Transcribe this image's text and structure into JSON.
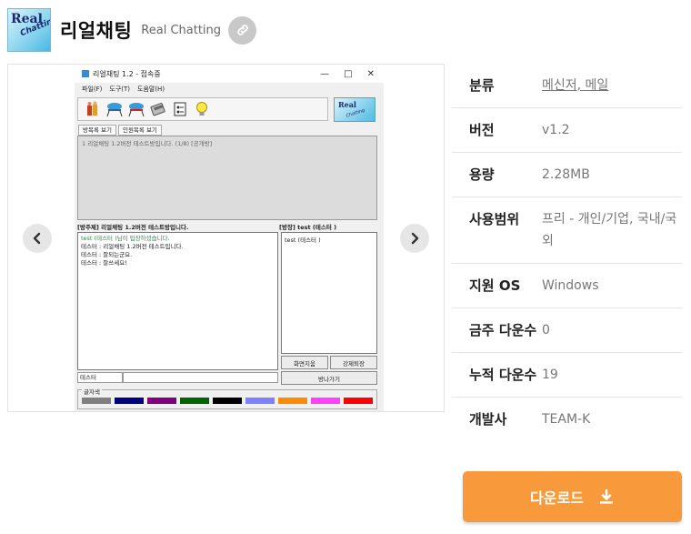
{
  "app": {
    "logo_line1": "Real",
    "logo_line2": "Chatting",
    "title": "리얼채팅",
    "subtitle": "Real Chatting",
    "link_icon": "link-icon"
  },
  "screenshot": {
    "window_title": "리얼채팅 1.2 - 접속중",
    "window_controls": [
      "—",
      "□",
      "✕"
    ],
    "menu": [
      "파일(F)",
      "도구(T)",
      "도움말(H)"
    ],
    "logo_line1": "Real",
    "logo_line2": "Chatting",
    "tabs": [
      "방목록 보기",
      "인원목록 보기"
    ],
    "room_list_entry": "1  리얼채팅 1.2버전 테스트방입니다. (1/8) [공개방]",
    "room_bar": "[방주제] 리얼채팅 1.2버전 테스트방입니다.",
    "owner_bar": "[방장] test  (테스터          )",
    "chat_lines": [
      "test  (테스터         )님이 입장하셨습니다.",
      "테스터 : 리얼채팅 1.2버전 테스트입니다.",
      "테스터 : 잘되는군요.",
      "테스터 : 잘쓰세요!"
    ],
    "user_list_entry": "test   (테스터          )",
    "buttons": {
      "clear": "화면지움",
      "kick": "강제퇴장",
      "leave": "방나가기"
    },
    "nickname": "테스터",
    "color_label": "글자색",
    "swatch_colors": [
      "#808080",
      "#000080",
      "#800080",
      "#006400",
      "#000000",
      "#8080ff",
      "#ff8c00",
      "#ff40ff",
      "#ff0000"
    ],
    "prev_icon": "chevron-left-icon",
    "next_icon": "chevron-right-icon"
  },
  "info": {
    "category_label": "분류",
    "category_value": "메신저, 메일",
    "version_label": "버전",
    "version_value": "v1.2",
    "size_label": "용량",
    "size_value": "2.28MB",
    "license_label": "사용범위",
    "license_value": "프리 - 개인/기업, 국내/국외",
    "os_label": "지원 OS",
    "os_value": "Windows",
    "weekly_label": "금주 다운수",
    "weekly_value": "0",
    "total_label": "누적 다운수",
    "total_value": "19",
    "dev_label": "개발사",
    "dev_value": "TEAM-K"
  },
  "download": {
    "label": "다운로드",
    "icon": "download-icon",
    "color": "#f89a3c"
  }
}
